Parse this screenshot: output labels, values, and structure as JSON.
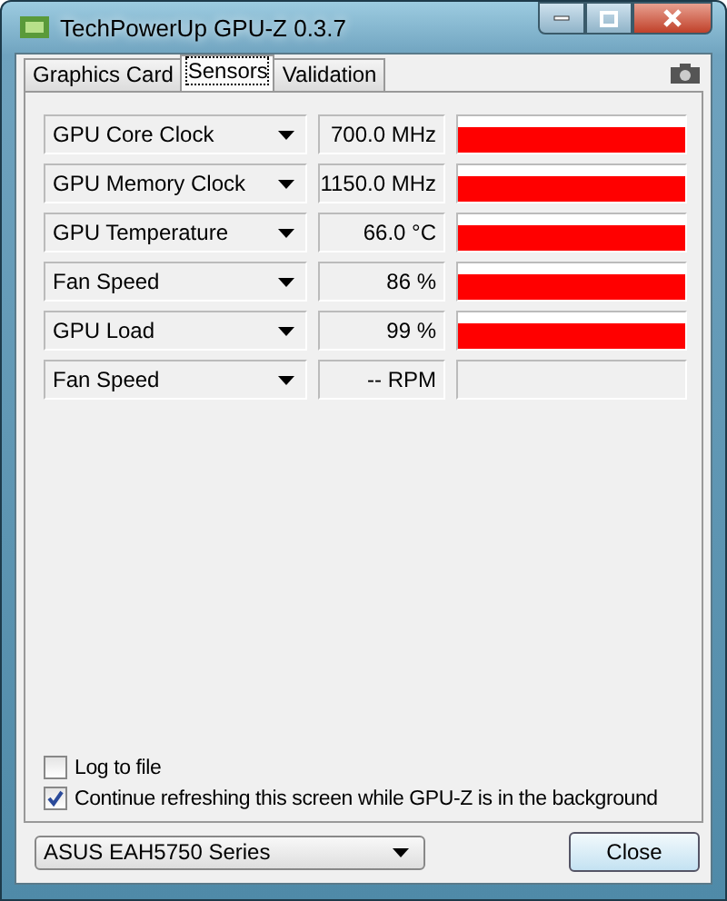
{
  "window": {
    "title": "TechPowerUp GPU-Z 0.3.7"
  },
  "tabs": [
    {
      "label": "Graphics Card",
      "selected": false
    },
    {
      "label": "Sensors",
      "selected": true
    },
    {
      "label": "Validation",
      "selected": false
    }
  ],
  "sensors": [
    {
      "name": "GPU Core Clock",
      "reading": "700.0 MHz",
      "graph_active": true
    },
    {
      "name": "GPU Memory Clock",
      "reading": "1150.0 MHz",
      "graph_active": true
    },
    {
      "name": "GPU Temperature",
      "reading": "66.0 °C",
      "graph_active": true
    },
    {
      "name": "Fan Speed",
      "reading": "86 %",
      "graph_active": true
    },
    {
      "name": "GPU Load",
      "reading": "99 %",
      "graph_active": true
    },
    {
      "name": "Fan Speed",
      "reading": "-- RPM",
      "graph_active": false
    }
  ],
  "options": [
    {
      "label": "Log to file",
      "checked": false
    },
    {
      "label": "Continue refreshing this screen while GPU-Z is in the background",
      "checked": true
    }
  ],
  "card_select": {
    "value": "ASUS EAH5750 Series"
  },
  "buttons": [
    "Close"
  ]
}
